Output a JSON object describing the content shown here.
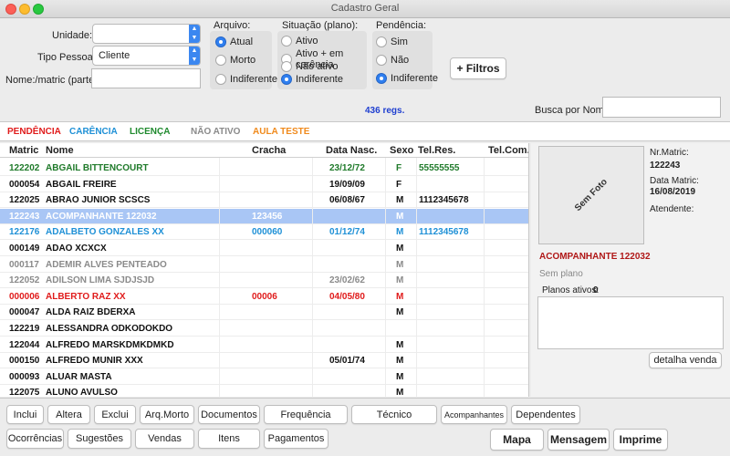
{
  "window": {
    "title": "Cadastro Geral"
  },
  "filters": {
    "unidade_label": "Unidade:",
    "unidade_value": "",
    "tipo_pessoa_label": "Tipo Pessoa:",
    "tipo_pessoa_value": "Cliente",
    "nome_label": "Nome:/matric (parte):",
    "nome_value": ""
  },
  "arquivo": {
    "title": "Arquivo:",
    "options": [
      "Atual",
      "Morto",
      "Indiferente"
    ],
    "selected": 0
  },
  "situacao": {
    "title": "Situação (plano):",
    "options": [
      "Ativo",
      "Ativo + em carência",
      "Não ativo",
      "Indiferente"
    ],
    "selected": 3
  },
  "pendencia": {
    "title": "Pendência:",
    "options": [
      "Sim",
      "Não",
      "Indiferente"
    ],
    "selected": 2
  },
  "mais_filtros_label": "+ Filtros",
  "record_count": "436 regs.",
  "busca": {
    "label": "Busca por Nome:",
    "value": ""
  },
  "legend": [
    {
      "label": "PENDÊNCIA",
      "color": "#e01b1b"
    },
    {
      "label": "CARÊNCIA",
      "color": "#1e90d6"
    },
    {
      "label": "LICENÇA",
      "color": "#1f8a2e"
    },
    {
      "label": "NÃO ATIVO",
      "color": "#8a8a8a"
    },
    {
      "label": "AULA TESTE",
      "color": "#f08a1c"
    }
  ],
  "table": {
    "headers": [
      "Matric",
      "Nome",
      "Cracha",
      "Data Nasc.",
      "Sexo",
      "Tel.Res.",
      "Tel.Com."
    ],
    "rows": [
      {
        "matric": "122202",
        "nome": "ABGAIL BITTENCOURT",
        "cracha": "",
        "nasc": "23/12/72",
        "sexo": "F",
        "telres": "55555555",
        "telcom": "",
        "color": "#1f7a2a",
        "selected": false
      },
      {
        "matric": "000054",
        "nome": "ABGAIL FREIRE",
        "cracha": "",
        "nasc": "19/09/09",
        "sexo": "F",
        "telres": "",
        "telcom": "",
        "color": "#111111",
        "selected": false
      },
      {
        "matric": "122025",
        "nome": "ABRAO JUNIOR SCSCS",
        "cracha": "",
        "nasc": "06/08/67",
        "sexo": "M",
        "telres": "1112345678",
        "telcom": "",
        "color": "#111111",
        "selected": false
      },
      {
        "matric": "122243",
        "nome": "ACOMPANHANTE 122032",
        "cracha": "123456",
        "nasc": "",
        "sexo": "M",
        "telres": "",
        "telcom": "",
        "color": "#ffffff",
        "selected": true
      },
      {
        "matric": "122176",
        "nome": "ADALBETO GONZALES XX",
        "cracha": "000060",
        "nasc": "01/12/74",
        "sexo": "M",
        "telres": "1112345678",
        "telcom": "",
        "color": "#1e90d6",
        "selected": false
      },
      {
        "matric": "000149",
        "nome": "ADAO XCXCX",
        "cracha": "",
        "nasc": "",
        "sexo": "M",
        "telres": "",
        "telcom": "",
        "color": "#111111",
        "selected": false
      },
      {
        "matric": "000117",
        "nome": "ADEMIR ALVES PENTEADO",
        "cracha": "",
        "nasc": "",
        "sexo": "M",
        "telres": "",
        "telcom": "",
        "color": "#8a8a8a",
        "selected": false
      },
      {
        "matric": "122052",
        "nome": "ADILSON LIMA SJDJSJD",
        "cracha": "",
        "nasc": "23/02/62",
        "sexo": "M",
        "telres": "",
        "telcom": "",
        "color": "#8a8a8a",
        "selected": false
      },
      {
        "matric": "000006",
        "nome": "ALBERTO RAZ XX",
        "cracha": "00006",
        "nasc": "04/05/80",
        "sexo": "M",
        "telres": "",
        "telcom": "",
        "color": "#e01b1b",
        "selected": false
      },
      {
        "matric": "000047",
        "nome": "ALDA RAIZ BDERXA",
        "cracha": "",
        "nasc": "",
        "sexo": "M",
        "telres": "",
        "telcom": "",
        "color": "#111111",
        "selected": false
      },
      {
        "matric": "122219",
        "nome": "ALESSANDRA ODKODOKDO",
        "cracha": "",
        "nasc": "",
        "sexo": "",
        "telres": "",
        "telcom": "",
        "color": "#111111",
        "selected": false
      },
      {
        "matric": "122044",
        "nome": "ALFREDO MARSKDMKDMKD",
        "cracha": "",
        "nasc": "",
        "sexo": "M",
        "telres": "",
        "telcom": "",
        "color": "#111111",
        "selected": false
      },
      {
        "matric": "000150",
        "nome": "ALFREDO MUNIR XXX",
        "cracha": "",
        "nasc": "05/01/74",
        "sexo": "M",
        "telres": "",
        "telcom": "",
        "color": "#111111",
        "selected": false
      },
      {
        "matric": "000093",
        "nome": "ALUAR MASTA",
        "cracha": "",
        "nasc": "",
        "sexo": "M",
        "telres": "",
        "telcom": "",
        "color": "#111111",
        "selected": false
      },
      {
        "matric": "122075",
        "nome": "ALUNO AVULSO",
        "cracha": "",
        "nasc": "",
        "sexo": "M",
        "telres": "",
        "telcom": "",
        "color": "#111111",
        "selected": false
      }
    ]
  },
  "detail": {
    "photo_label": "Sem Foto",
    "nr_matric_label": "Nr.Matric:",
    "nr_matric_value": "122243",
    "data_matric_label": "Data Matric:",
    "data_matric_value": "16/08/2019",
    "atendente_label": "Atendente:",
    "atendente_value": "",
    "nome": "ACOMPANHANTE 122032",
    "plano": "Sem plano",
    "planos_ativos_label": "Planos ativos:",
    "planos_ativos_value": "0",
    "detalha_venda_label": "detalha venda"
  },
  "buttons": {
    "inclui": "Inclui",
    "altera": "Altera",
    "exclui": "Exclui",
    "arq_morto": "Arq.Morto",
    "documentos": "Documentos",
    "frequencia": "Frequência",
    "tecnico": "Técnico",
    "acompanhantes": "Acompanhantes",
    "dependentes": "Dependentes",
    "ocorrencias": "Ocorrências",
    "sugestoes": "Sugestões",
    "vendas": "Vendas",
    "itens": "Itens",
    "pagamentos": "Pagamentos",
    "mapa": "Mapa",
    "mensagem": "Mensagem",
    "imprime": "Imprime"
  }
}
